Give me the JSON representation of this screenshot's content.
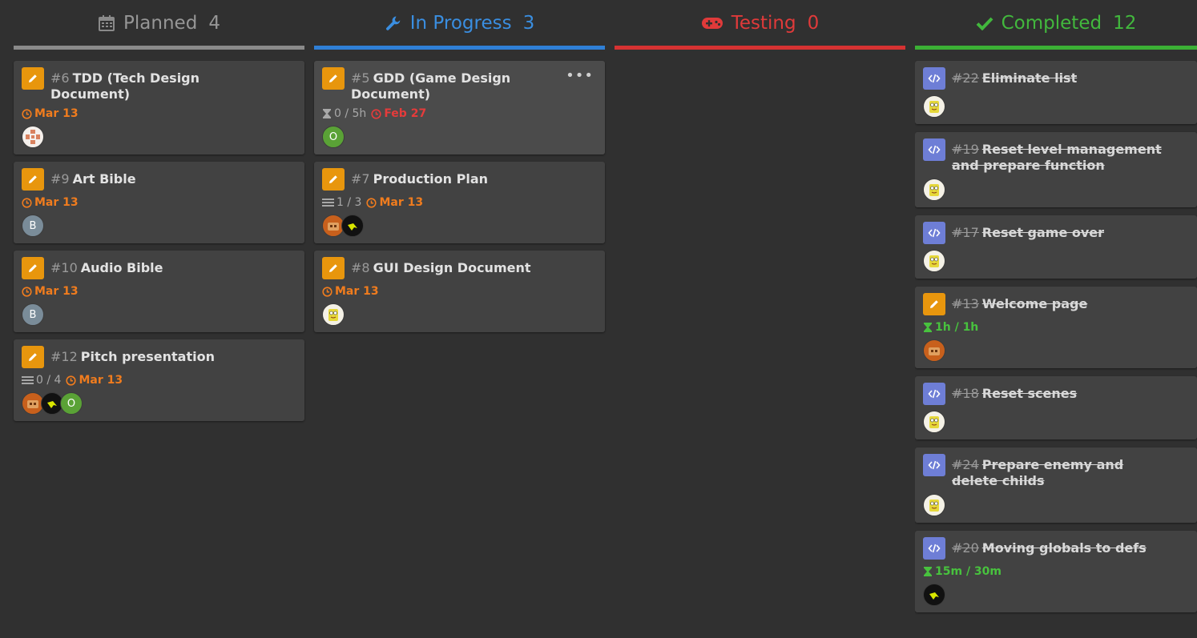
{
  "columns": [
    {
      "title": "Planned",
      "count": "4",
      "icon": "calendar-icon",
      "color": "#8a8a8a"
    },
    {
      "title": "In Progress",
      "count": "3",
      "icon": "wrench-icon",
      "color": "#2f7fd6"
    },
    {
      "title": "Testing",
      "count": "0",
      "icon": "gamepad-icon",
      "color": "#d63232"
    },
    {
      "title": "Completed",
      "count": "12",
      "icon": "check-icon",
      "color": "#3bb035"
    }
  ],
  "planned": [
    {
      "num": "#6",
      "title": "TDD (Tech Design Document)",
      "date": "Mar 13",
      "avatars": [
        "pattern"
      ]
    },
    {
      "num": "#9",
      "title": "Art Bible",
      "date": "Mar 13",
      "avatar_letter": "B"
    },
    {
      "num": "#10",
      "title": "Audio Bible",
      "date": "Mar 13",
      "avatar_letter": "B"
    },
    {
      "num": "#12",
      "title": "Pitch presentation",
      "checklist": "0 / 4",
      "date": "Mar 13",
      "avatar_letter": "O"
    }
  ],
  "in_progress": [
    {
      "num": "#5",
      "title": "GDD (Game Design Document)",
      "time": "0 / 5h",
      "date": "Feb 27",
      "avatar_letter": "O",
      "more": "•••"
    },
    {
      "num": "#7",
      "title": "Production Plan",
      "checklist": "1 / 3",
      "date": "Mar 13"
    },
    {
      "num": "#8",
      "title": "GUI Design Document",
      "date": "Mar 13"
    }
  ],
  "completed": [
    {
      "num": "#22",
      "title": "Eliminate list",
      "type": "code"
    },
    {
      "num": "#19",
      "title": "Reset level management and prepare function",
      "type": "code"
    },
    {
      "num": "#17",
      "title": "Reset game over",
      "type": "code"
    },
    {
      "num": "#13",
      "title": "Welcome page",
      "type": "doc",
      "time": "1h / 1h"
    },
    {
      "num": "#18",
      "title": "Reset scenes",
      "type": "code"
    },
    {
      "num": "#24",
      "title": "Prepare enemy and delete childs",
      "type": "code"
    },
    {
      "num": "#20",
      "title": "Moving globals to defs",
      "type": "code",
      "time": "15m / 30m"
    }
  ],
  "colors": {
    "background": "#303030",
    "card": "#424242",
    "doc_icon": "#e8960d",
    "code_icon": "#6e7ed6",
    "due_date": "#f07c1e",
    "overdue": "#e53b3b",
    "time_done": "#48c23e"
  }
}
